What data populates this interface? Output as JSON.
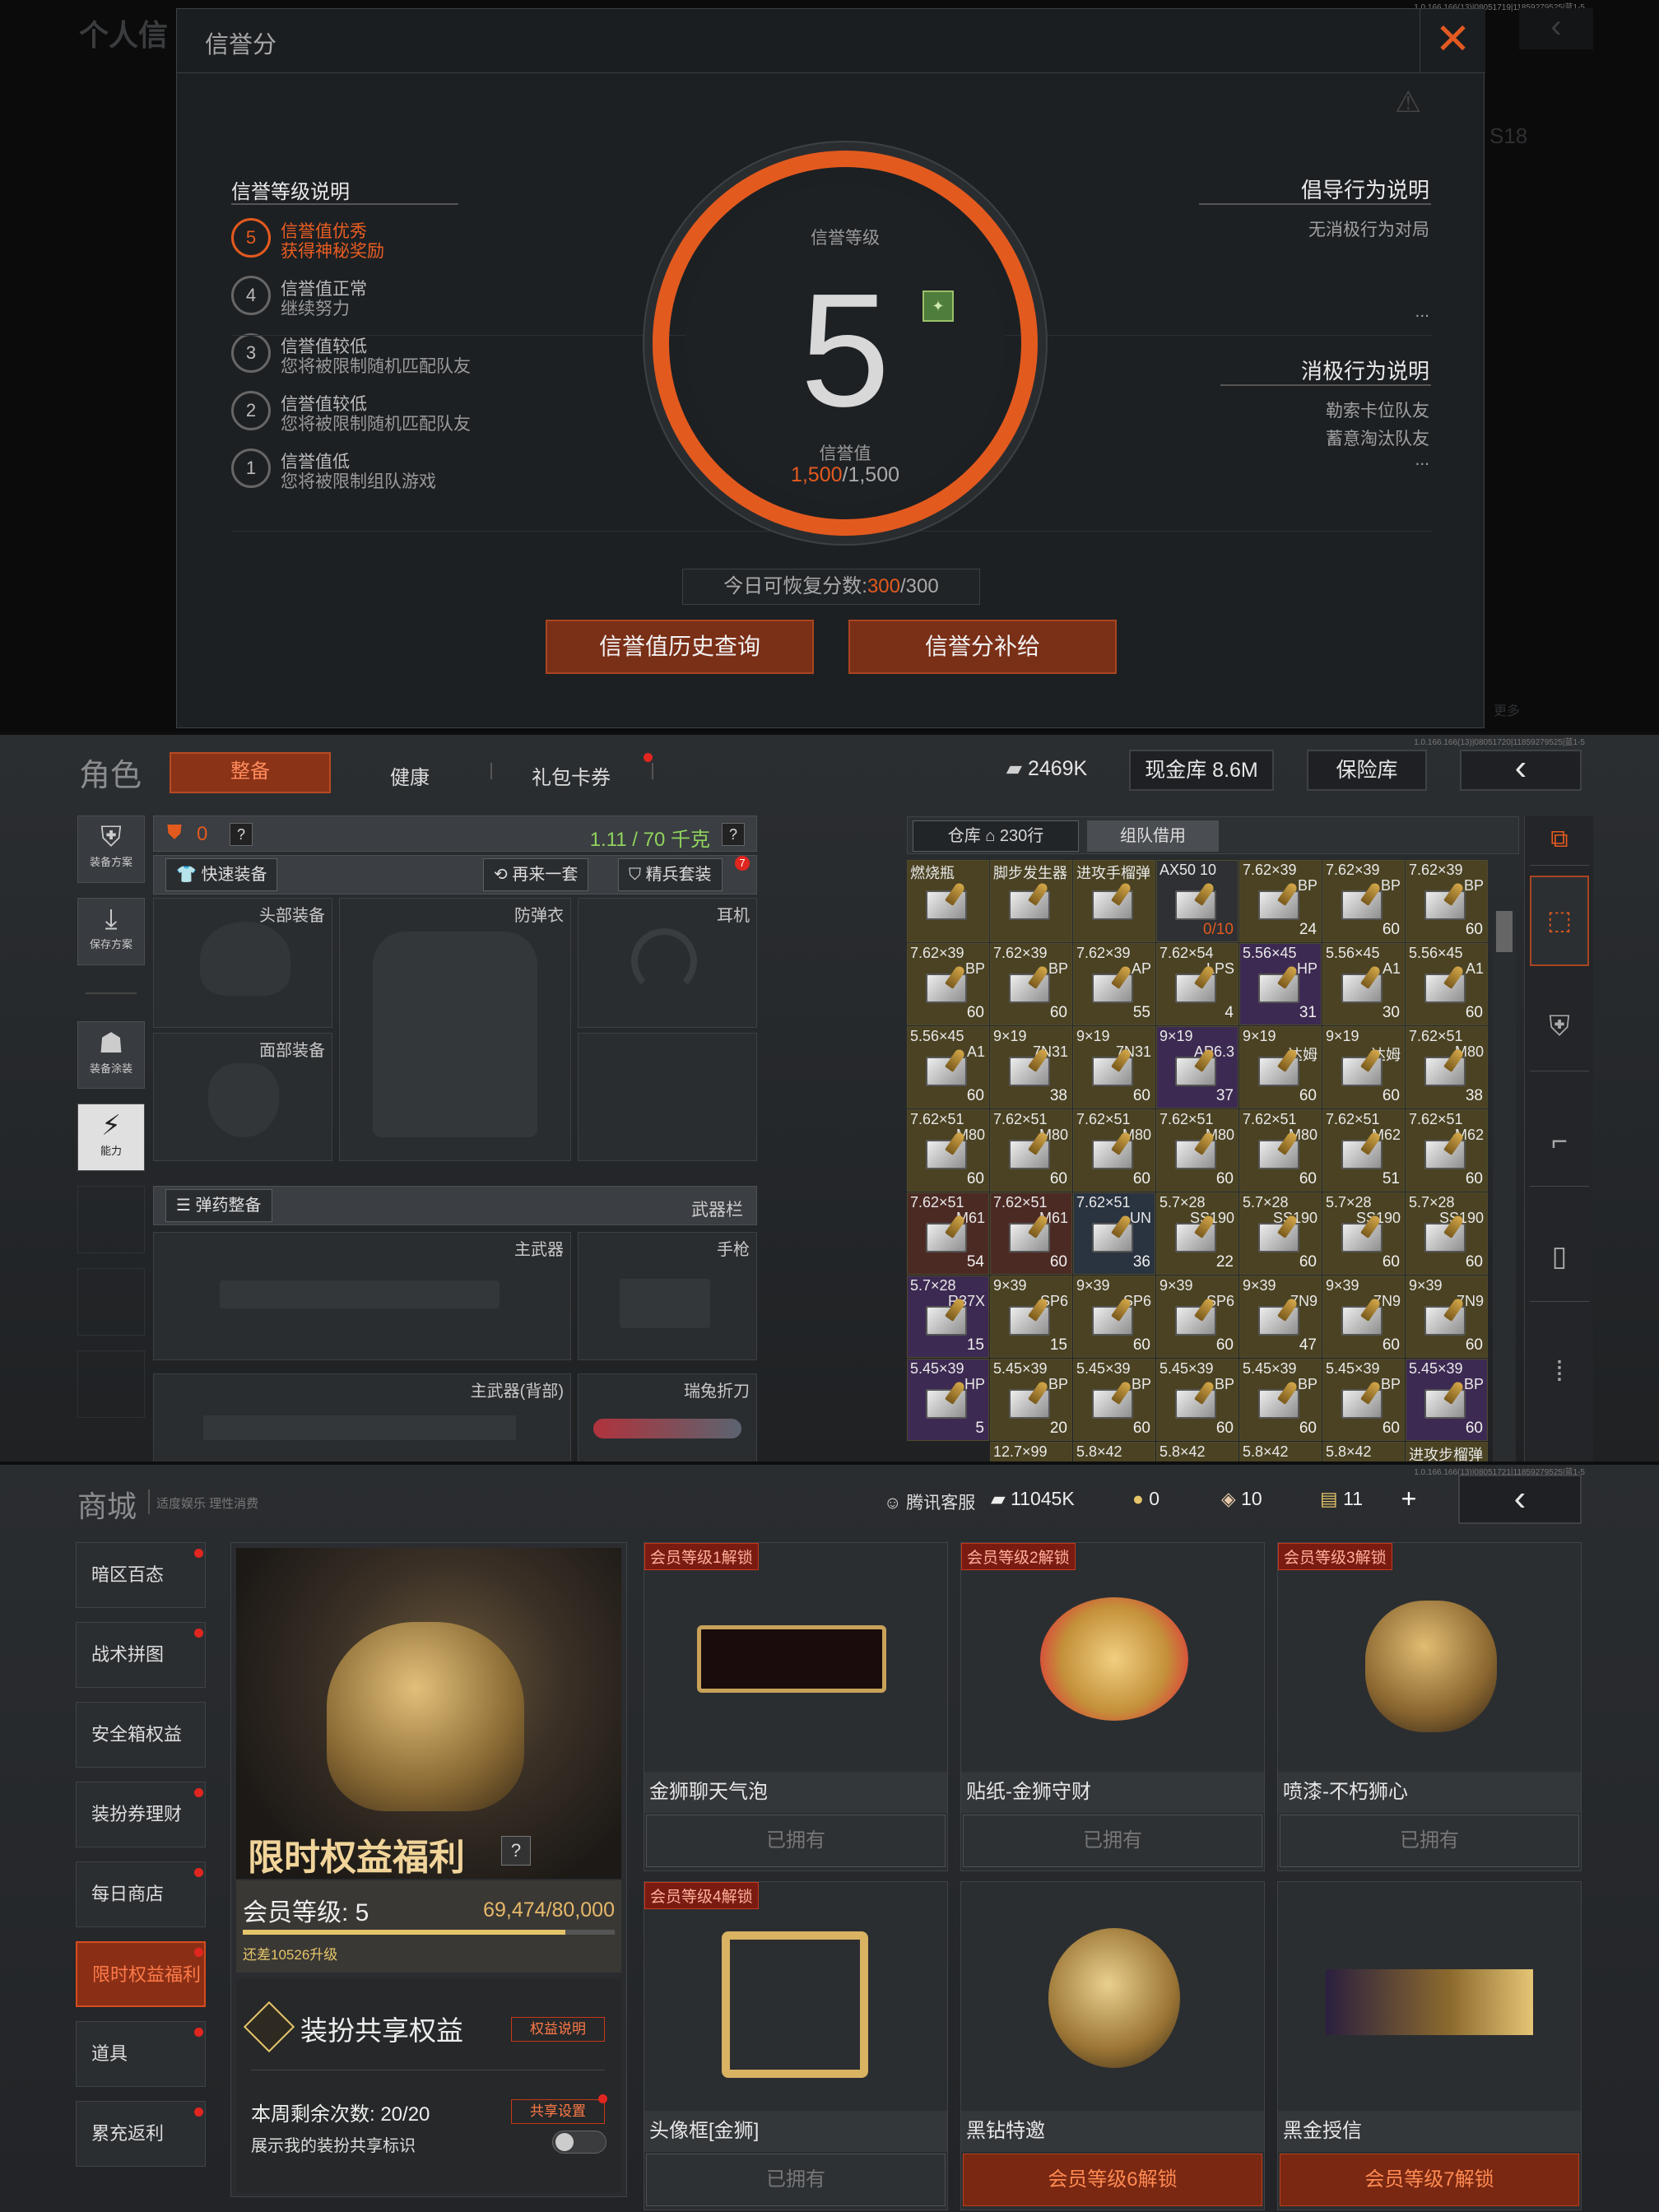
{
  "credit_modal": {
    "background_title": "个人信",
    "title": "信誉分",
    "level_header": "信誉等级说明",
    "levels": [
      {
        "num": "5",
        "line1": "信誉值优秀",
        "line2": "获得神秘奖励",
        "active": true
      },
      {
        "num": "4",
        "line1": "信誉值正常",
        "line2": "继续努力"
      },
      {
        "num": "3",
        "line1": "信誉值较低",
        "line2": "您将被限制随机匹配队友"
      },
      {
        "num": "2",
        "line1": "信誉值较低",
        "line2": "您将被限制随机匹配队友"
      },
      {
        "num": "1",
        "line1": "信誉值低",
        "line2": "您将被限制组队游戏"
      }
    ],
    "ring": {
      "level_label": "信誉等级",
      "level_value": "5",
      "score_label": "信誉值",
      "score_current": "1,500",
      "score_max": "/1,500"
    },
    "guide_header": "倡导行为说明",
    "guide_items": [
      "无消极行为对局"
    ],
    "negative_header": "消极行为说明",
    "negative_items": [
      "勒索卡位队友",
      "蓄意淘汰队友"
    ],
    "ellipsis": "...",
    "recover_label": "今日可恢复分数:",
    "recover_current": "300",
    "recover_max": "/300",
    "btn_history": "信誉值历史查询",
    "btn_supplement": "信誉分补给",
    "bg_side_code": "S18",
    "bg_more": "更多",
    "version_text": "1.0.166.166(13)|08051719|11859279525|蓝1-5"
  },
  "equipment": {
    "title": "角色",
    "tabs": [
      "整备",
      "健康",
      "礼包卡券"
    ],
    "coins": "2469K",
    "cash_storage": "现金库 8.6M",
    "safe_box": "保险库",
    "side_buttons": [
      "装备方案",
      "保存方案",
      "装备涂装",
      "能力"
    ],
    "armor_value": "0",
    "weight": "1.11 / 70 千克",
    "quick_equip": "快速装备",
    "again": "再来一套",
    "elite_set": "精兵套装",
    "elite_badge": "7",
    "slots": {
      "head": "头部装备",
      "vest": "防弹衣",
      "ear": "耳机",
      "face": "面部装备"
    },
    "ammo_bar": "弹药整备",
    "weapon_bar": "武器栏",
    "weapons": {
      "primary": "主武器",
      "pistol": "手枪",
      "primary_back": "主武器(背部)",
      "knife": "瑞兔折刀"
    },
    "storage_tab": "仓库",
    "storage_rows": "230行",
    "team_tab": "组队借用",
    "version_text": "1.0.166.166(13)|08051720|11859279525|蓝1-5",
    "inventory": [
      [
        "燃烧瓶",
        "",
        "",
        "yellow"
      ],
      [
        "脚步发生器",
        "",
        "",
        "yellow"
      ],
      [
        "进攻手榴弹",
        "",
        "",
        "yellow"
      ],
      [
        "AX50 10",
        "",
        "0/10",
        "gray"
      ],
      [
        "7.62×39",
        "BP",
        "24",
        "yellow"
      ],
      [
        "7.62×39",
        "BP",
        "60",
        "yellow"
      ],
      [
        "7.62×39",
        "BP",
        "60",
        "yellow"
      ],
      [
        "7.62×39",
        "BP",
        "60",
        "yellow"
      ],
      [
        "7.62×39",
        "BP",
        "60",
        "yellow"
      ],
      [
        "7.62×39",
        "AP",
        "55",
        "yellow"
      ],
      [
        "7.62×54",
        "LPS",
        "4",
        "yellow"
      ],
      [
        "5.56×45",
        "HP",
        "31",
        "purple"
      ],
      [
        "5.56×45",
        "A1",
        "30",
        "yellow"
      ],
      [
        "5.56×45",
        "A1",
        "60",
        "yellow"
      ],
      [
        "5.56×45",
        "A1",
        "60",
        "yellow"
      ],
      [
        "9×19",
        "7N31",
        "38",
        "yellow"
      ],
      [
        "9×19",
        "7N31",
        "60",
        "yellow"
      ],
      [
        "9×19",
        "AP6.3",
        "37",
        "purple"
      ],
      [
        "9×19",
        "达姆",
        "60",
        "yellow"
      ],
      [
        "9×19",
        "达姆",
        "60",
        "yellow"
      ],
      [
        "7.62×51",
        "M80",
        "38",
        "yellow"
      ],
      [
        "7.62×51",
        "M80",
        "60",
        "yellow"
      ],
      [
        "7.62×51",
        "M80",
        "60",
        "yellow"
      ],
      [
        "7.62×51",
        "M80",
        "60",
        "yellow"
      ],
      [
        "7.62×51",
        "M80",
        "60",
        "yellow"
      ],
      [
        "7.62×51",
        "M80",
        "60",
        "yellow"
      ],
      [
        "7.62×51",
        "M62",
        "51",
        "yellow"
      ],
      [
        "7.62×51",
        "M62",
        "60",
        "yellow"
      ],
      [
        "7.62×51",
        "M61",
        "54",
        "red"
      ],
      [
        "7.62×51",
        "M61",
        "60",
        "red"
      ],
      [
        "7.62×51",
        "UN",
        "36",
        "blue"
      ],
      [
        "5.7×28",
        "SS190",
        "22",
        "yellow"
      ],
      [
        "5.7×28",
        "SS190",
        "60",
        "yellow"
      ],
      [
        "5.7×28",
        "SS190",
        "60",
        "yellow"
      ],
      [
        "5.7×28",
        "SS190",
        "60",
        "yellow"
      ],
      [
        "5.7×28",
        "R37X",
        "15",
        "purple"
      ],
      [
        "9×39",
        "SP6",
        "15",
        "yellow"
      ],
      [
        "9×39",
        "SP6",
        "60",
        "yellow"
      ],
      [
        "9×39",
        "SP6",
        "60",
        "yellow"
      ],
      [
        "9×39",
        "7N9",
        "47",
        "yellow"
      ],
      [
        "9×39",
        "7N9",
        "60",
        "yellow"
      ],
      [
        "9×39",
        "7N9",
        "60",
        "yellow"
      ],
      [
        "5.45×39",
        "HP",
        "5",
        "purple"
      ],
      [
        "5.45×39",
        "BP",
        "20",
        "yellow"
      ],
      [
        "5.45×39",
        "BP",
        "60",
        "yellow"
      ],
      [
        "5.45×39",
        "BP",
        "60",
        "yellow"
      ],
      [
        "5.45×39",
        "BP",
        "60",
        "yellow"
      ],
      [
        "5.45×39",
        "BP",
        "60",
        "yellow"
      ],
      [
        "5.45×39",
        "BP",
        "60",
        "purple"
      ]
    ],
    "partial_row": [
      "12.7×99",
      "5.8×42",
      "5.8×42",
      "5.8×42",
      "5.8×42",
      "进攻步榴弹"
    ]
  },
  "shop": {
    "title": "商城",
    "subtitle": "适度娱乐 理性消费",
    "service": "腾讯客服",
    "currency_coins": "11045K",
    "currency_a": "0",
    "currency_b": "10",
    "currency_c": "11",
    "nav": [
      "暗区百态",
      "战术拼图",
      "安全箱权益",
      "装扮券理财",
      "每日商店",
      "限时权益福利",
      "道具",
      "累充返利"
    ],
    "banner_title": "限时权益福利",
    "member_level": "会员等级: 5",
    "member_points": "69,474/80,000",
    "member_progress": 0.868,
    "member_next": "还差10526升级",
    "share_title": "装扮共享权益",
    "share_explain": "权益说明",
    "weekly_left": "本周剩余次数: 20/20",
    "share_setting": "共享设置",
    "show_share": "展示我的装扮共享标识",
    "cards": [
      {
        "tag": "会员等级1解锁",
        "name": "金狮聊天气泡",
        "btn": "已拥有",
        "locked": false
      },
      {
        "tag": "会员等级2解锁",
        "name": "贴纸-金狮守财",
        "btn": "已拥有",
        "locked": false
      },
      {
        "tag": "会员等级3解锁",
        "name": "喷漆-不朽狮心",
        "btn": "已拥有",
        "locked": false
      },
      {
        "tag": "会员等级4解锁",
        "name": "头像框[金狮]",
        "btn": "已拥有",
        "locked": false
      },
      {
        "tag": "",
        "name": "黑钻特邀",
        "btn": "会员等级6解锁",
        "locked": true
      },
      {
        "tag": "",
        "name": "黑金授信",
        "btn": "会员等级7解锁",
        "locked": true
      }
    ],
    "version_text": "1.0.166.166(13)|08051721|11859279525|蓝1-5"
  },
  "colors": {
    "accent": "#e35a1f",
    "gold": "#e6c56a",
    "green": "#8fd35c"
  }
}
